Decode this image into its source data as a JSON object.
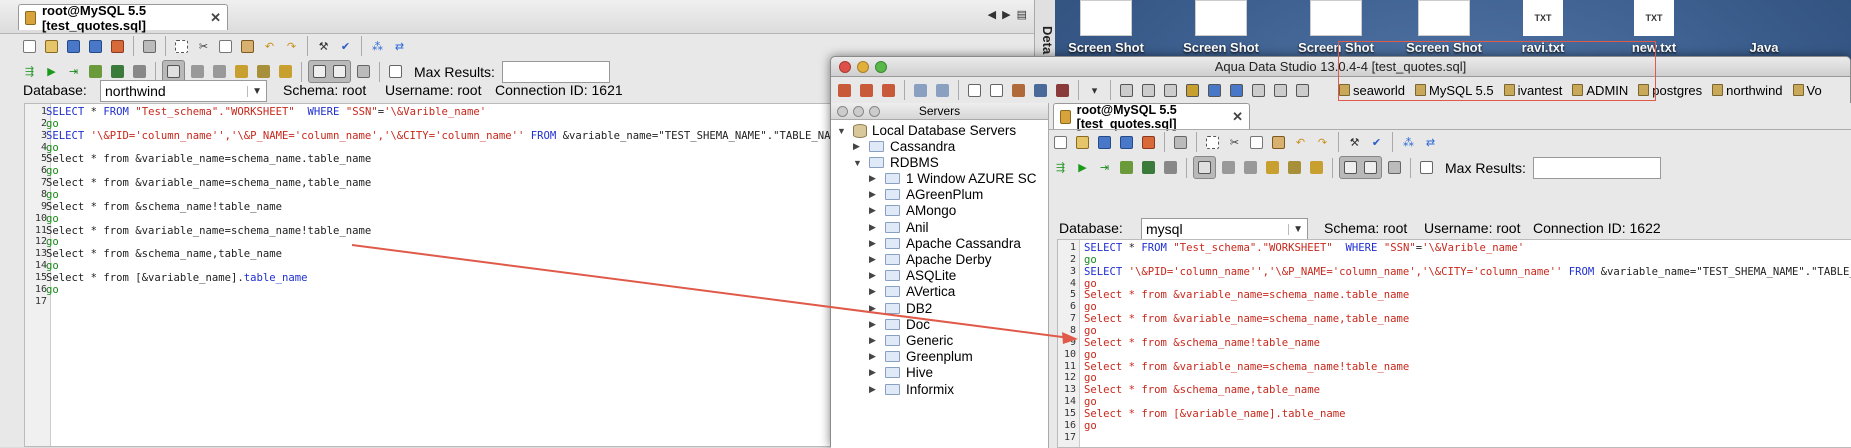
{
  "win1": {
    "tab_title": "root@MySQL 5.5 [test_quotes.sql]",
    "side_panel_label": "Deta",
    "max_results_label": "Max Results:",
    "database_label": "Database:",
    "database_value": "northwind",
    "schema_text": "Schema:  root",
    "username_text": "Username:  root",
    "connection_text": "Connection ID:  1621"
  },
  "desktop": {
    "icons": [
      {
        "label": "Screen Shot",
        "type": "image"
      },
      {
        "label": "Screen Shot",
        "type": "image"
      },
      {
        "label": "Screen Shot",
        "type": "image"
      },
      {
        "label": "Screen Shot",
        "type": "image"
      },
      {
        "label": "ravi.txt",
        "type": "txt",
        "badge": "TXT"
      },
      {
        "label": "new.txt",
        "type": "txt",
        "badge": "TXT"
      },
      {
        "label": "Java",
        "type": "folder"
      }
    ]
  },
  "win2": {
    "window_title": "Aqua Data Studio 13.0.4-4 [test_quotes.sql]",
    "connections": [
      "seaworld",
      "MySQL 5.5",
      "ivantest",
      "ADMIN",
      "postgres",
      "northwind",
      "Vo"
    ],
    "servers_header": "Servers",
    "tree": {
      "root": "Local Database Servers",
      "cassandra": "Cassandra",
      "rdbms": "RDBMS",
      "children": [
        "1 Window AZURE SC",
        "AGreenPlum",
        "AMongo",
        "Anil",
        "Apache Cassandra",
        "Apache Derby",
        "ASQLite",
        "AVertica",
        "DB2",
        "Doc",
        "Generic",
        "Greenplum",
        "Hive",
        "Informix"
      ]
    },
    "tab_title": "root@MySQL 5.5 [test_quotes.sql]",
    "max_results_label": "Max Results:",
    "database_label": "Database:",
    "database_value": "mysql",
    "schema_text": "Schema:  root",
    "username_text": "Username:  root",
    "connection_text": "Connection ID:  1622"
  },
  "editor": {
    "line_numbers": [
      "1",
      "2",
      "3",
      "4",
      "5",
      "6",
      "7",
      "8",
      "9",
      "10",
      "11",
      "12",
      "13",
      "14",
      "15",
      "16",
      "17"
    ],
    "lines": [
      [
        {
          "t": "SELECT ",
          "c": "kw"
        },
        {
          "t": "* ",
          "c": "tx"
        },
        {
          "t": "FROM ",
          "c": "kw"
        },
        {
          "t": "\"Test_schema\".\"WORKSHEET\"  ",
          "c": "st"
        },
        {
          "t": "WHERE ",
          "c": "kw"
        },
        {
          "t": "\"SSN\"",
          "c": "st"
        },
        {
          "t": "=",
          "c": "tx"
        },
        {
          "t": "'\\&Varible_name'",
          "c": "st"
        }
      ],
      [
        {
          "t": "go",
          "c": "go"
        }
      ],
      [
        {
          "t": "SELECT ",
          "c": "kw"
        },
        {
          "t": "'\\&PID='column_name'','\\&P_NAME='column_name','\\&CITY='column_name'' ",
          "c": "st"
        },
        {
          "t": "FROM ",
          "c": "kw"
        },
        {
          "t": "&variable_name=\"TEST_SHEMA_NAME\".\"TABLE_NAME\"",
          "c": "tx"
        }
      ],
      [
        {
          "t": "go",
          "c": "go"
        }
      ],
      [
        {
          "t": "Select * from &variable_name=schema_name.table_name",
          "c": "tx"
        }
      ],
      [
        {
          "t": "go",
          "c": "go"
        }
      ],
      [
        {
          "t": "Select * from &variable_name=schema_name,table_name",
          "c": "tx"
        }
      ],
      [
        {
          "t": "go",
          "c": "go"
        }
      ],
      [
        {
          "t": "Select * from &schema_name!table_name",
          "c": "tx"
        }
      ],
      [
        {
          "t": "go",
          "c": "go"
        }
      ],
      [
        {
          "t": "Select * from &variable_name=schema_name!table_name",
          "c": "tx"
        }
      ],
      [
        {
          "t": "go",
          "c": "go"
        }
      ],
      [
        {
          "t": "Select * from &schema_name,table_name",
          "c": "tx"
        }
      ],
      [
        {
          "t": "go",
          "c": "go"
        }
      ],
      [
        {
          "t": "Select * from [&variable_name].",
          "c": "tx"
        },
        {
          "t": "table_name",
          "c": "kw"
        }
      ],
      [
        {
          "t": "go",
          "c": "go"
        }
      ],
      []
    ]
  },
  "colors": {
    "keyword": "#1f2fd0",
    "string": "#c8281c",
    "text": "#222222",
    "go": "#1a8a1a",
    "error": "#c8281c",
    "arrow": "#e05a4a"
  }
}
